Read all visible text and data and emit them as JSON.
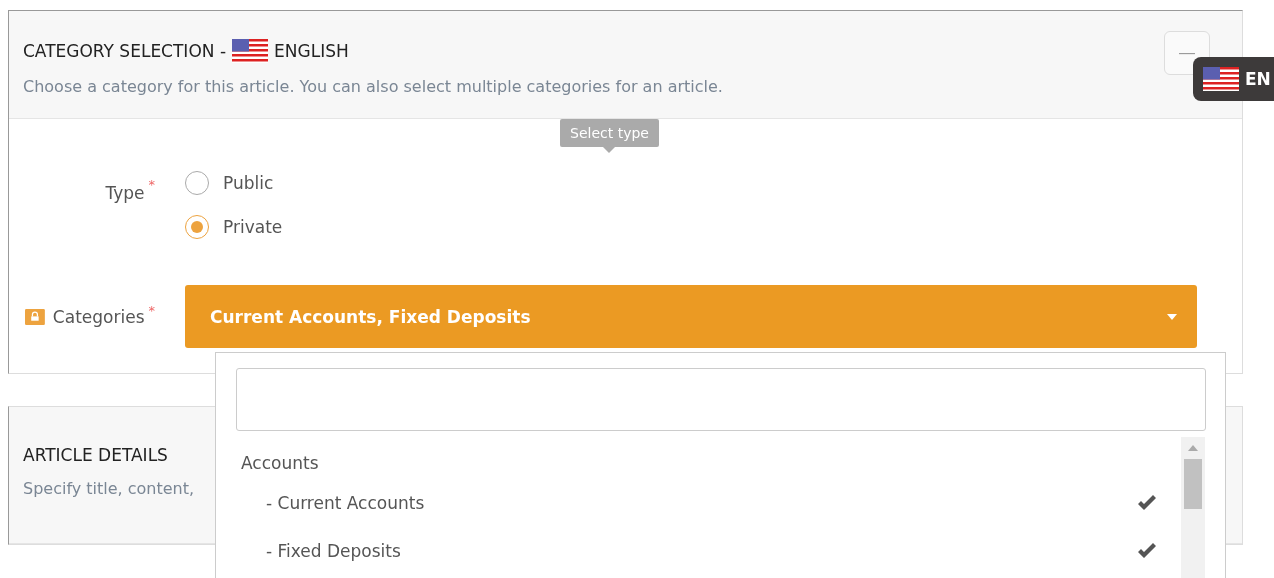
{
  "category_panel": {
    "title_prefix": "CATEGORY SELECTION -",
    "title_language": "ENGLISH",
    "description": "Choose a category for this article. You can also select multiple categories for an article.",
    "collapse_label": "—"
  },
  "language_badge": {
    "label": "EN"
  },
  "tooltip": {
    "text": "Select type"
  },
  "type_field": {
    "label": "Type",
    "required_mark": "*",
    "options": [
      {
        "label": "Public",
        "selected": false
      },
      {
        "label": "Private",
        "selected": true
      }
    ]
  },
  "categories_field": {
    "label": "Categories",
    "required_mark": "*",
    "value": "Current Accounts, Fixed Deposits",
    "expanded": true
  },
  "dropdown": {
    "groups": [
      {
        "label": "Accounts",
        "children": [
          {
            "label": "- Current Accounts",
            "checked": true
          },
          {
            "label": "- Fixed Deposits",
            "checked": true
          }
        ]
      }
    ]
  },
  "article_panel": {
    "title": "ARTICLE DETAILS",
    "description": "Specify title, content,"
  }
}
